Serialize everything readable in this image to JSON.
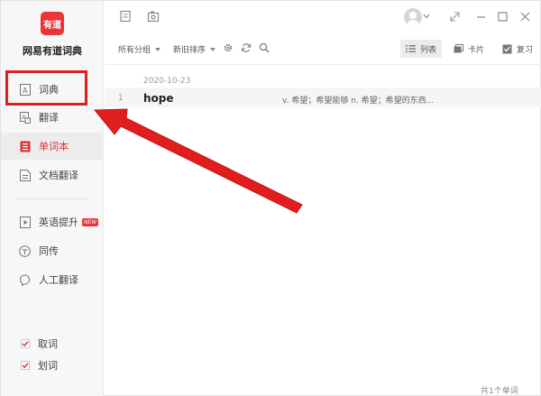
{
  "sidebar": {
    "logo_text": "有道",
    "app_name": "网易有道词典",
    "nav": [
      {
        "label": "词典"
      },
      {
        "label": "翻译"
      },
      {
        "label": "单词本"
      },
      {
        "label": "文档翻译"
      },
      {
        "label": "英语提升",
        "badge": "NEW"
      },
      {
        "label": "同传"
      },
      {
        "label": "人工翻译"
      }
    ],
    "options": [
      {
        "label": "取词",
        "checked": true
      },
      {
        "label": "划词",
        "checked": true
      }
    ]
  },
  "toolbar": {
    "group_label": "所有分组",
    "sort_label": "新旧排序",
    "view_list_label": "列表",
    "view_card_label": "卡片",
    "review_label": "复习"
  },
  "list": {
    "date": "2020-10-23",
    "entries": [
      {
        "num": "1",
        "word": "hope",
        "definition": "v. 希望；希望能够  n. 希望；希望的东西..."
      }
    ]
  },
  "status": {
    "count_text": "共1个单词"
  },
  "colors": {
    "brand_red": "#e93538",
    "annotation_red": "#e01e1e"
  }
}
